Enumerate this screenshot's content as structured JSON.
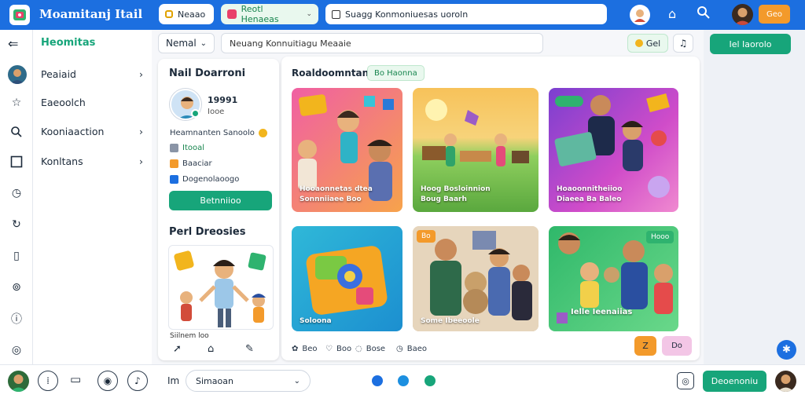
{
  "app": {
    "title": "Moamitanj Itail"
  },
  "topbar": {
    "tab1": "Neaao",
    "tab2": "Reotl Henaeas",
    "url": "Suagg Konmoniuesas uoroln",
    "orange_button": "Geo",
    "accent": "#1c6fe0"
  },
  "sidebar": {
    "header": "Heomitas",
    "items": [
      {
        "label": "Peaiaid",
        "chevron": true
      },
      {
        "label": "Eaeoolch",
        "chevron": false
      },
      {
        "label": "Kooniaaction",
        "chevron": true
      },
      {
        "label": "Konltans",
        "chevron": true
      }
    ]
  },
  "toolbar": {
    "dropdown": "Nemal",
    "search": "Neuang Konnuitiagu Meaaie",
    "chip": "Gel",
    "right_button": "Iel Iaorolo"
  },
  "profile": {
    "title": "Nail Doarroni",
    "name": "19991",
    "sub": "Iooe",
    "line1": "Heamnanten Sanoolo",
    "item1": "Itooal",
    "item2": "Baaciar",
    "item3": "Dogenolaoogo",
    "button": "Betnniioo",
    "section2": "Perl Dreosies",
    "caption": "Siilnem loo"
  },
  "feed": {
    "title": "Roaldoomntans",
    "tag": "Bo Haonna",
    "tiles": [
      {
        "caption": "Hooaonnetas dtea",
        "sub": "Sonnniiaee Boo"
      },
      {
        "caption": "Hoog Bosloinnion",
        "sub": "Boug Baarh"
      },
      {
        "caption": "Hoaoonnitheiioo",
        "sub": "Diaeea Ba Baleo"
      },
      {
        "caption": "Soloona",
        "sub": ""
      },
      {
        "caption": "Some Ibeeoole",
        "sub": ""
      },
      {
        "caption": "Ielle Ieenaiias",
        "sub": ""
      }
    ],
    "badge_a": "Bo",
    "badge_b": "Hooo",
    "meta": [
      "Beo",
      "Boo",
      "Bose",
      "Baeo"
    ],
    "btn_orange": "Z",
    "btn_pink": "Do"
  },
  "bottombar": {
    "label": "Im",
    "select": "Simaoan",
    "button": "Deoenoniu"
  }
}
